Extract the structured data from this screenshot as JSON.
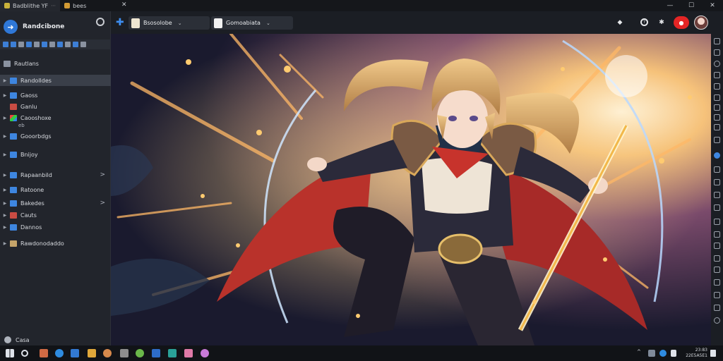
{
  "tabs": [
    {
      "title": "Badblithe YF",
      "color": "#c9b23b"
    },
    {
      "title": "bees",
      "color": "#d19a34"
    }
  ],
  "window_controls": {
    "minimize": "—",
    "maximize": "☐",
    "close": "✕"
  },
  "sidebar": {
    "brand": "Randcibone",
    "sections_label": "Rautlans",
    "items": [
      {
        "label": "Randolldes",
        "icon": "folder-icon",
        "selected": true
      },
      {
        "label": "Gaoss",
        "icon": "folder-icon"
      },
      {
        "label": "Ganlu",
        "icon": "red-file-icon"
      },
      {
        "label": "Caooshoxe",
        "icon": "multicolor-app-icon",
        "sub": "eb"
      },
      {
        "label": "Gooorbdgs",
        "icon": "folder-icon"
      },
      {
        "label": "Bnijoy",
        "icon": "folder-icon"
      },
      {
        "label": "Rapaanbild",
        "icon": "folder-icon",
        "chevron": true
      },
      {
        "label": "Ratoone",
        "icon": "folder-icon"
      },
      {
        "label": "Bakedes",
        "icon": "folder-icon",
        "chevron": true
      },
      {
        "label": "Cauts",
        "icon": "red-file-icon"
      },
      {
        "label": "Dannos",
        "icon": "folder-icon"
      },
      {
        "label": "Rawdonodaddo",
        "icon": "tan-folder-icon"
      }
    ],
    "footer": "Casa"
  },
  "appbar": {
    "plus": "✚",
    "chip1": {
      "label": "Bsosolobe"
    },
    "chip2": {
      "label": "Gomoabiata"
    },
    "dropdown_glyph": "⌄",
    "rec_glyph": "●"
  },
  "taskbar": {
    "time": "23:83",
    "date": "22E5A5E1"
  },
  "colors": {
    "accent": "#2f78d8",
    "record": "#e42525"
  }
}
